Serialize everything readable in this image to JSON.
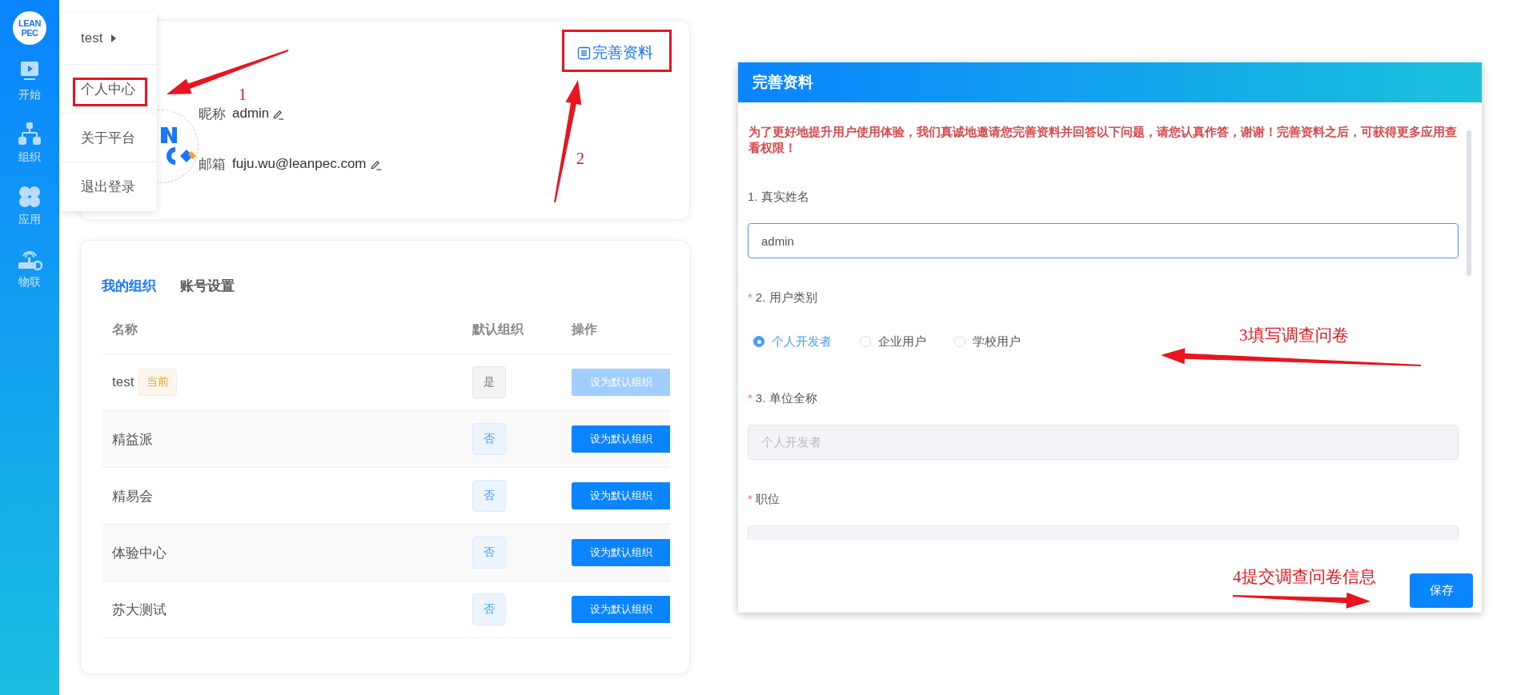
{
  "sidebar": {
    "logo": {
      "line1": "LEAN",
      "line2": "PEC"
    },
    "items": [
      {
        "label": "开始",
        "kind": "start"
      },
      {
        "label": "组织",
        "kind": "org"
      },
      {
        "label": "应用",
        "kind": "apps"
      },
      {
        "label": "物联",
        "kind": "iot"
      }
    ]
  },
  "user_menu": {
    "items": [
      {
        "label": "test",
        "submenu": true
      },
      {
        "label": "个人中心",
        "submenu": false
      },
      {
        "label": "关于平台",
        "submenu": false
      },
      {
        "label": "退出登录",
        "submenu": false
      }
    ]
  },
  "profile": {
    "complete_button": "完善资料",
    "fields": [
      {
        "label": "昵称",
        "value": "admin"
      },
      {
        "label": "邮箱",
        "value": "fuju.wu@leanpec.com"
      }
    ]
  },
  "organizations": {
    "tabs": [
      {
        "label": "我的组织",
        "selected": true
      },
      {
        "label": "账号设置",
        "selected": false
      }
    ],
    "columns": [
      "名称",
      "默认组织",
      "操作"
    ],
    "rows": [
      {
        "name": "test",
        "tag": "当前",
        "default_label": "是",
        "default": true,
        "action": "设为默认组织",
        "disabled": true
      },
      {
        "name": "精益派",
        "default_label": "否",
        "default": false,
        "action": "设为默认组织",
        "disabled": false
      },
      {
        "name": "精易会",
        "default_label": "否",
        "default": false,
        "action": "设为默认组织",
        "disabled": false
      },
      {
        "name": "体验中心",
        "default_label": "否",
        "default": false,
        "action": "设为默认组织",
        "disabled": false
      },
      {
        "name": "苏大测试",
        "default_label": "否",
        "default": false,
        "action": "设为默认组织",
        "disabled": false
      }
    ]
  },
  "dialog": {
    "title": "完善资料",
    "notice": "为了更好地提升用户使用体验，我们真诚地邀请您完善资料并回答以下问题，请您认真作答，谢谢！完善资料之后，可获得更多应用查看权限！",
    "questions": [
      {
        "kind": "text",
        "label": "1. 真实姓名",
        "value": "admin",
        "focused": true,
        "disabled": false
      },
      {
        "kind": "radio",
        "label": "2. 用户类别",
        "required_mark": "*",
        "options": [
          {
            "label": "个人开发者",
            "selected": true
          },
          {
            "label": "企业用户",
            "selected": false
          },
          {
            "label": "学校用户",
            "selected": false
          }
        ]
      },
      {
        "kind": "text",
        "label": "3. 单位全称",
        "required_mark": "*",
        "placeholder": "个人开发者",
        "focused": false,
        "disabled": true
      },
      {
        "kind": "text",
        "label": "职位",
        "required_mark": "*",
        "focused": false,
        "disabled": true
      }
    ],
    "save_button": "保存"
  },
  "annotations": [
    {
      "label": "1"
    },
    {
      "label": "2"
    },
    {
      "label": "3填写调查问卷"
    },
    {
      "label": "4提交调查问卷信息"
    }
  ]
}
